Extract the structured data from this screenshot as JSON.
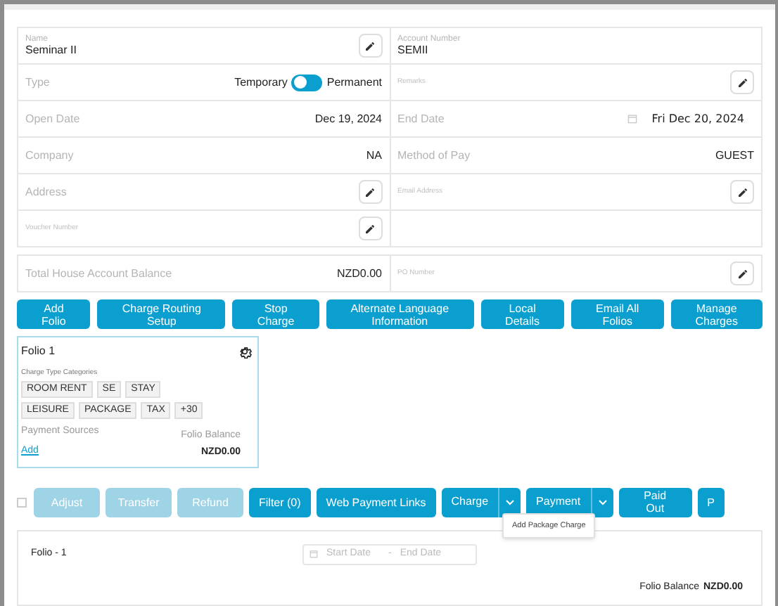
{
  "form": {
    "rows": [
      [
        {
          "kind": "stacked",
          "label": "Name",
          "value": "Seminar II",
          "editable": true
        },
        {
          "kind": "stacked",
          "label": "Account Number",
          "value": "SEMII"
        }
      ],
      [
        {
          "kind": "toggle",
          "label": "Type",
          "off_label": "Temporary",
          "on_label": "Permanent",
          "on": false
        },
        {
          "kind": "hint",
          "label": "Remarks",
          "editable": true
        }
      ],
      [
        {
          "kind": "pair",
          "label": "Open Date",
          "value": "Dec 19, 2024"
        },
        {
          "kind": "date",
          "label": "End Date",
          "value": "Fri Dec 20, 2024"
        }
      ],
      [
        {
          "kind": "pair",
          "label": "Company",
          "value": "NA"
        },
        {
          "kind": "pair",
          "label": "Method of Pay",
          "value": "GUEST"
        }
      ],
      [
        {
          "kind": "pair",
          "label": "Address",
          "editable": true
        },
        {
          "kind": "hint",
          "label": "Email Address",
          "editable": true
        }
      ],
      [
        {
          "kind": "hint",
          "label": "Voucher Number",
          "editable": true
        },
        {
          "kind": "empty"
        }
      ]
    ]
  },
  "balance_row": [
    {
      "kind": "pair",
      "label": "Total House Account Balance",
      "value": "NZD0.00"
    },
    {
      "kind": "hint",
      "label": "PO Number",
      "editable": true
    }
  ],
  "buttons": [
    "Add\nFolio",
    "Charge Routing\nSetup",
    "Stop\nCharge",
    "Alternate Language\nInformation",
    "Local\nDetails",
    "Email All\nFolios",
    "Manage\nCharges"
  ],
  "folio_card": {
    "title": "Folio 1",
    "categories_label": "Charge Type Categories",
    "tags": [
      "ROOM RENT",
      "SE",
      "STAY",
      "LEISURE",
      "PACKAGE",
      "TAX",
      "+30"
    ],
    "payment_label": "Payment Sources",
    "add_link": "Add",
    "balance_label": "Folio Balance",
    "balance": "NZD0.00"
  },
  "action_bar": {
    "select_all": {
      "checked": false
    },
    "buttons": [
      {
        "kind": "plain",
        "label": "Adjust",
        "disabled": true
      },
      {
        "kind": "plain",
        "label": "Transfer",
        "disabled": true
      },
      {
        "kind": "plain",
        "label": "Refund",
        "disabled": true
      },
      {
        "kind": "plain",
        "label": "Filter (0)",
        "disabled": false
      },
      {
        "kind": "plain",
        "label": "Web Payment Links",
        "disabled": false
      },
      {
        "kind": "split",
        "label": "Charge",
        "disabled": false
      },
      {
        "kind": "split",
        "label": "Payment",
        "disabled": false
      },
      {
        "kind": "plain",
        "label": "Paid\nOut",
        "disabled": false
      },
      {
        "kind": "plain",
        "label": "P",
        "disabled": false
      }
    ]
  },
  "tooltip": "Add Package Charge",
  "folio_panel": {
    "title": "Folio - 1",
    "start_placeholder": "Start Date",
    "separator": "-",
    "end_placeholder": "End Date",
    "balance_label": "Folio Balance",
    "balance": "NZD0.00"
  }
}
